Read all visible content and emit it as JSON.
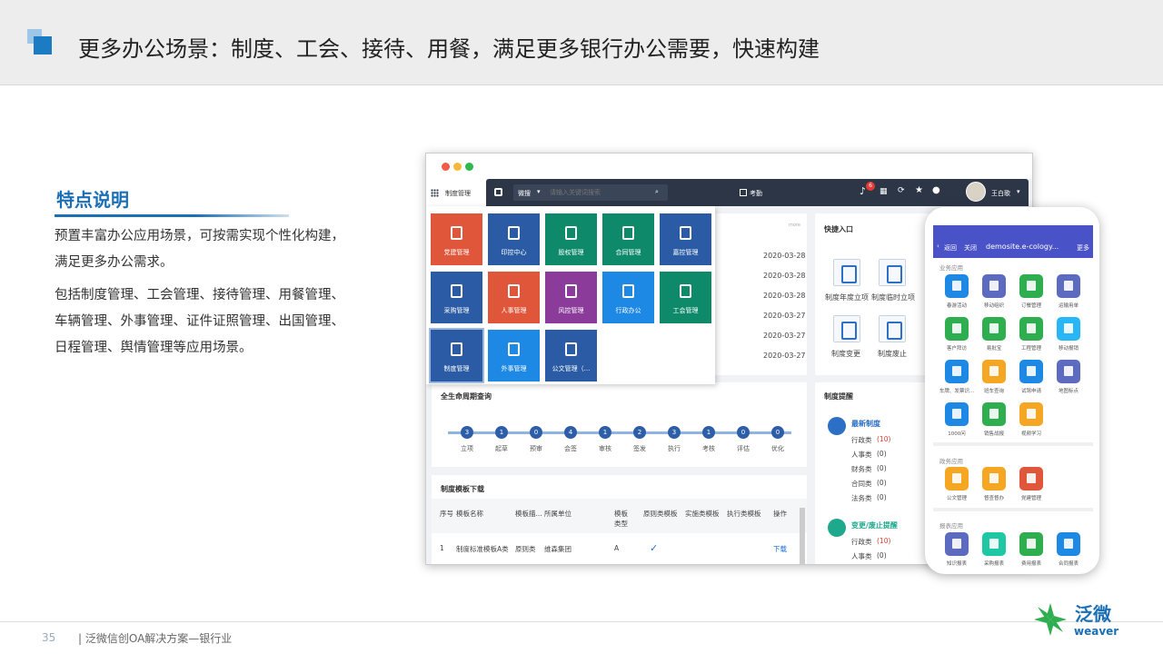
{
  "slide": {
    "title": "更多办公场景：制度、工会、接待、用餐，满足更多银行办公需要，快速构建",
    "feature_title": "特点说明",
    "para1": "预置丰富办公应用场景，可按需实现个性化构建，满足更多办公需求。",
    "para2": "包括制度管理、工会管理、接待管理、用餐管理、车辆管理、外事管理、证件证照管理、出国管理、日程管理、舆情管理等应用场景。",
    "page_num": "35",
    "footer": "| 泛微信创OA解决方案—银行业",
    "logo_text": "泛微",
    "logo_sub": "weaver"
  },
  "desktop": {
    "module": "制度管理",
    "search_scope": "微搜",
    "search_placeholder": "请输入关键词搜索",
    "attendance": "考勤",
    "notify_count": "6",
    "user": "王白歌",
    "tiles": [
      {
        "label": "党建管理",
        "color": "#e0563b"
      },
      {
        "label": "印控中心",
        "color": "#2a5ba4"
      },
      {
        "label": "股权管理",
        "color": "#0e8a6a"
      },
      {
        "label": "合同管理",
        "color": "#0e8a6a"
      },
      {
        "label": "嘉控管理",
        "color": "#2a5ba4"
      },
      {
        "label": "采购管理",
        "color": "#2a5ba4"
      },
      {
        "label": "人事管理",
        "color": "#e0563b"
      },
      {
        "label": "风控管理",
        "color": "#8b3c9a"
      },
      {
        "label": "行政办公",
        "color": "#1e88e5"
      },
      {
        "label": "工会管理",
        "color": "#0e8a6a"
      },
      {
        "label": "制度管理",
        "color": "#2a5ba4"
      },
      {
        "label": "外事管理",
        "color": "#1e88e5"
      },
      {
        "label": "公文管理（...",
        "color": "#2a5ba4"
      }
    ],
    "dates": [
      "2020-03-28",
      "2020-03-28",
      "2020-03-28",
      "2020-03-27",
      "2020-03-27",
      "2020-03-27"
    ],
    "quick_title": "快捷入口",
    "quick": [
      "制度年度立项",
      "制度临时立项",
      "制度变更",
      "制度废止"
    ],
    "lifecycle_title": "全生命周期查询",
    "lifecycle": [
      {
        "n": "3",
        "label": "立项"
      },
      {
        "n": "1",
        "label": "起草"
      },
      {
        "n": "0",
        "label": "预审"
      },
      {
        "n": "4",
        "label": "会签"
      },
      {
        "n": "1",
        "label": "审核"
      },
      {
        "n": "2",
        "label": "签发"
      },
      {
        "n": "3",
        "label": "执行"
      },
      {
        "n": "1",
        "label": "考核"
      },
      {
        "n": "0",
        "label": "评估"
      },
      {
        "n": "0",
        "label": "优化"
      }
    ],
    "remind_title": "制度提醒",
    "latest_title": "最新制度",
    "latest": [
      "行政类",
      "(10)",
      "人事类",
      "(0)",
      "财务类",
      "(0)",
      "合同类",
      "(0)",
      "法务类",
      "(0)"
    ],
    "change_title": "变更/废止提醒",
    "change": [
      "行政类",
      "(10)",
      "人事类",
      "(0)"
    ],
    "template_title": "制度模板下载",
    "table_headers": [
      "序号",
      "模板名称",
      "模板描...",
      "所属单位",
      "模板类型",
      "原则类模板",
      "实施类模板",
      "执行类模板",
      "操作"
    ],
    "table_row": [
      "1",
      "制度标准模板A类",
      "原则类",
      "维森集团",
      "A",
      "✓",
      "下载"
    ],
    "panel_more": "more"
  },
  "mobile": {
    "back": "返回",
    "close": "关闭",
    "url": "demosite.e-cology...",
    "more": "更多",
    "sec1": "业务应用",
    "apps1": [
      {
        "label": "春游活动",
        "color": "#1e88e5"
      },
      {
        "label": "移动组织",
        "color": "#5c6bc0"
      },
      {
        "label": "订餐管理",
        "color": "#2eae4f"
      },
      {
        "label": "运输用单",
        "color": "#5c6bc0"
      },
      {
        "label": "客户拜访",
        "color": "#2eae4f"
      },
      {
        "label": "易批宝",
        "color": "#2eae4f"
      },
      {
        "label": "工程管理",
        "color": "#2eae4f"
      },
      {
        "label": "移动报销",
        "color": "#29b6f6"
      },
      {
        "label": "车牌、发票识...",
        "color": "#1e88e5"
      },
      {
        "label": "班车查询",
        "color": "#f5a623"
      },
      {
        "label": "试驾申请",
        "color": "#1e88e5"
      },
      {
        "label": "地图标点",
        "color": "#5c6bc0"
      },
      {
        "label": "1000问",
        "color": "#1e88e5"
      },
      {
        "label": "销售战报",
        "color": "#2eae4f"
      },
      {
        "label": "视频学习",
        "color": "#f5a623"
      }
    ],
    "sec2": "政务应用",
    "apps2": [
      {
        "label": "公文管理",
        "color": "#f5a623"
      },
      {
        "label": "督查督办",
        "color": "#f5a623"
      },
      {
        "label": "党建管理",
        "color": "#e0563b"
      }
    ],
    "sec3": "报表应用",
    "apps3": [
      {
        "label": "知识报表",
        "color": "#5c6bc0"
      },
      {
        "label": "采购报表",
        "color": "#1ec8a5"
      },
      {
        "label": "费用报表",
        "color": "#2eae4f"
      },
      {
        "label": "合同报表",
        "color": "#1e88e5"
      }
    ]
  }
}
